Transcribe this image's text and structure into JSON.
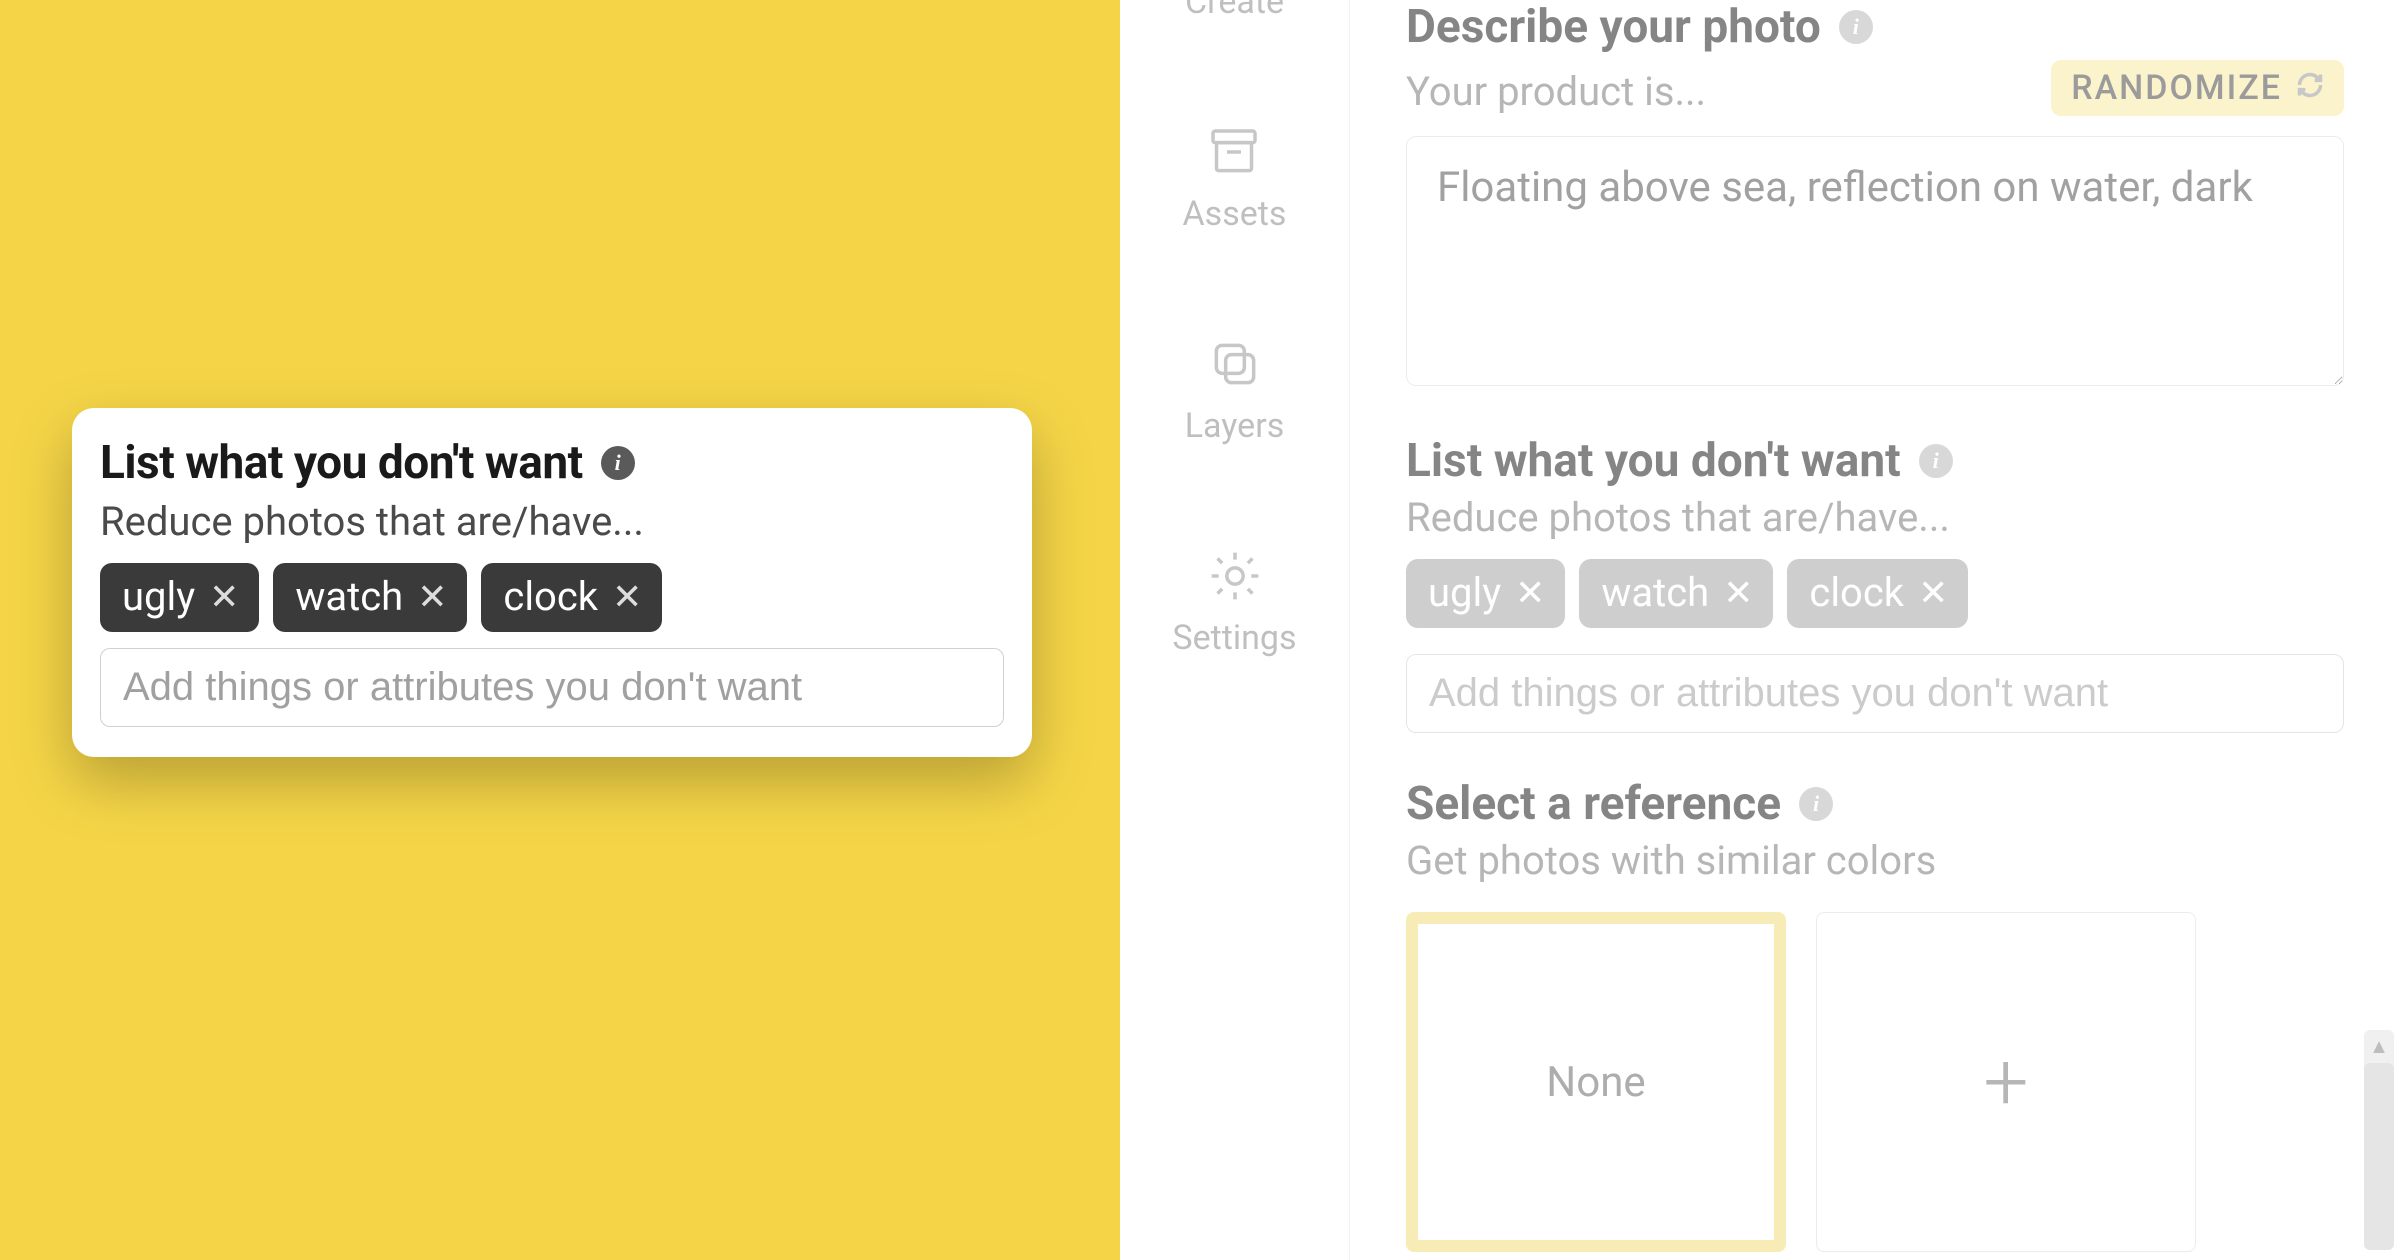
{
  "sidebar": {
    "create_label": "Create",
    "items": [
      {
        "label": "Assets",
        "icon": "archive-icon"
      },
      {
        "label": "Layers",
        "icon": "layers-icon"
      },
      {
        "label": "Settings",
        "icon": "gear-icon"
      }
    ]
  },
  "describe": {
    "heading": "Describe your photo",
    "subheading": "Your product is...",
    "randomize_label": "RANDOMIZE",
    "text": "Floating above sea, reflection on water, dark"
  },
  "negative": {
    "heading": "List what you don't want",
    "subheading": "Reduce photos that are/have...",
    "chips": [
      "ugly",
      "watch",
      "clock"
    ],
    "placeholder": "Add things or attributes you don't want"
  },
  "reference": {
    "heading": "Select a reference",
    "subheading": "Get photos with similar colors",
    "none_label": "None"
  },
  "callout": {
    "heading": "List what you don't want",
    "subheading": "Reduce photos that are/have...",
    "chips": [
      "ugly",
      "watch",
      "clock"
    ],
    "placeholder": "Add things or attributes you don't want"
  }
}
